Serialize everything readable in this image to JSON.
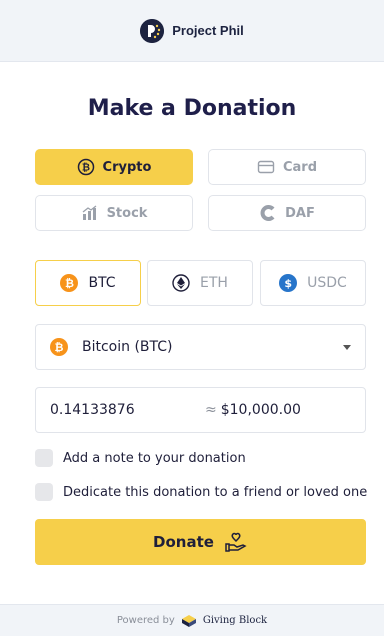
{
  "header": {
    "org_name": "Project Phil"
  },
  "page": {
    "title": "Make a Donation"
  },
  "methods": [
    {
      "label": "Crypto",
      "active": true,
      "icon": "bitcoin-icon"
    },
    {
      "label": "Card",
      "active": false,
      "icon": "card-icon"
    },
    {
      "label": "Stock",
      "active": false,
      "icon": "stock-icon"
    },
    {
      "label": "DAF",
      "active": false,
      "icon": "daf-icon"
    }
  ],
  "coins": [
    {
      "label": "BTC",
      "active": true,
      "icon": "btc-icon",
      "color": "#f7931a"
    },
    {
      "label": "ETH",
      "active": false,
      "icon": "eth-icon",
      "color": "#1f1f3a"
    },
    {
      "label": "USDC",
      "active": false,
      "icon": "usdc-icon",
      "color": "#2775ca"
    }
  ],
  "currency_select": {
    "value": "Bitcoin (BTC)",
    "icon": "btc-icon"
  },
  "amount": {
    "crypto_value": "0.14133876",
    "approx": "≈",
    "usd_value": "$10,000.00"
  },
  "options": {
    "note_label": "Add a note to your donation",
    "dedicate_label": "Dedicate this donation to a friend or loved one"
  },
  "donate_button": {
    "label": "Donate",
    "icon": "heart-hand-icon"
  },
  "footer": {
    "powered_by": "Powered by",
    "brand": "Giving Block"
  },
  "colors": {
    "accent": "#f6cf4a",
    "btc": "#f7931a",
    "usdc": "#2775ca",
    "header_bg": "#f1f4f8"
  }
}
